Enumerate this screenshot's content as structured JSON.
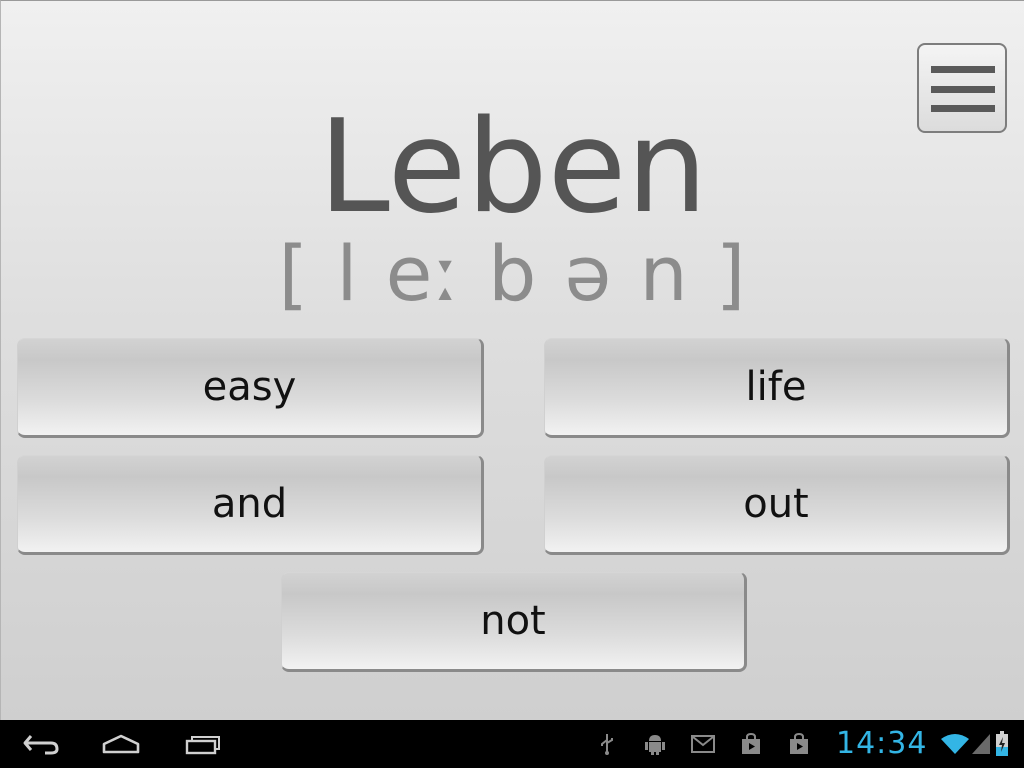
{
  "word": {
    "title": "Leben",
    "pronunciation": "[ l eː b ə n ]"
  },
  "menu": {
    "icon": "hamburger-menu-icon"
  },
  "answers": {
    "easy": "easy",
    "life": "life",
    "and": "and",
    "out": "out",
    "not": "not"
  },
  "system_bar": {
    "clock": "14:34",
    "clock_color": "#33b5e5",
    "nav_icons": [
      "back-icon",
      "home-icon",
      "recent-apps-icon"
    ],
    "status_icons": [
      "usb-icon",
      "android-debug-icon",
      "gmail-icon",
      "play-store-icon",
      "play-store-icon",
      "wifi-icon",
      "cell-signal-icon",
      "battery-charging-icon"
    ]
  },
  "colors": {
    "title": "#555555",
    "pronunciation": "#8c8c8c",
    "accent": "#33b5e5"
  }
}
